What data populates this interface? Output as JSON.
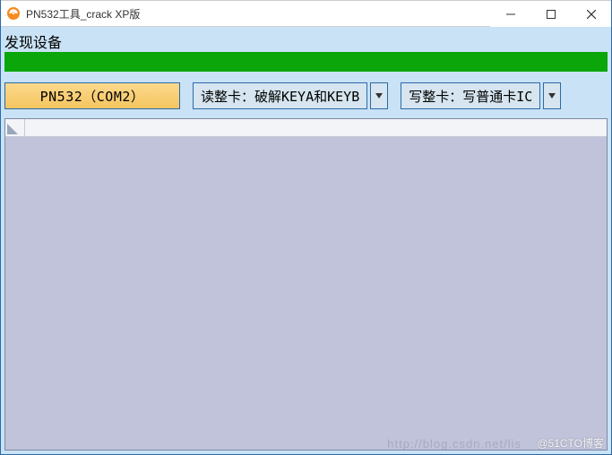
{
  "window": {
    "title": "PN532工具_crack XP版"
  },
  "header": {
    "status_label": "发现设备"
  },
  "toolbar": {
    "device_button": "PN532（COM2）",
    "read_button": "读整卡：破解KEYA和KEYB",
    "write_button": "写整卡：写普通卡IC"
  },
  "watermark": {
    "brand": "@51CTO博客",
    "faded": "http://blog.csdn.net/lis"
  }
}
